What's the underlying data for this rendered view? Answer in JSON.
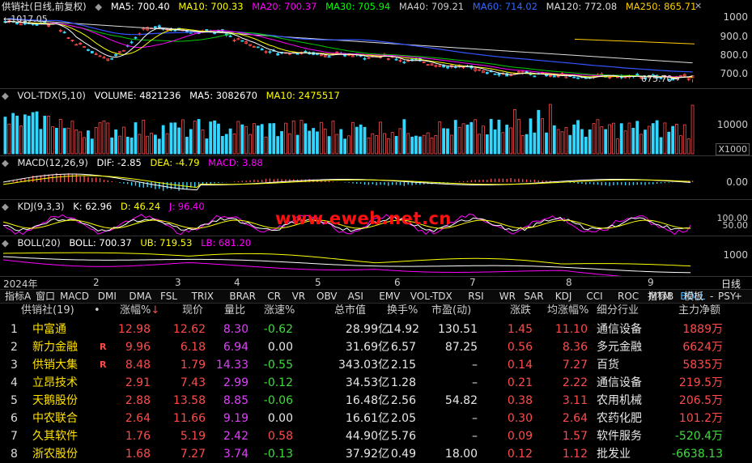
{
  "colors": {
    "up": "#ff4b4b",
    "down": "#33d6ff",
    "ma5": "#ffffff",
    "ma10": "#ffff00",
    "ma20": "#ff00ff",
    "ma30": "#00ff00",
    "ma40": "#cccccc",
    "ma60": "#3366ff",
    "ma120": "#dddddd",
    "ma250": "#ffcc00",
    "active_tab": "#49b6ff"
  },
  "price": {
    "title": "供销社(日线,前复权)",
    "ma5": "MA5: 700.40",
    "ma10": "MA10: 700.33",
    "ma20": "MA20: 700.37",
    "ma30": "MA30: 705.94",
    "ma40": "MA40: 709.21",
    "ma60": "MA60: 714.02",
    "ma120": "MA120: 772.08",
    "ma250": "MA250: 865.71",
    "high_label": "1017.05",
    "low_label": "675.70",
    "axis": [
      "1000",
      "900.0",
      "800.0",
      "700.0"
    ]
  },
  "volume": {
    "title": "VOL-TDX(5,10)",
    "volume": "VOLUME: 4821236",
    "ma5": "MA5: 3082670",
    "ma10": "MA10: 2475517",
    "axis": [
      "10000"
    ],
    "unit": "X1000"
  },
  "macd": {
    "title": "MACD(12,26,9)",
    "dif": "DIF: -2.85",
    "dea": "DEA: -4.79",
    "macd": "MACD: 3.88",
    "axis": [
      "0.00"
    ]
  },
  "kdj": {
    "title": "KDJ(9,3,3)",
    "k": "K: 62.96",
    "d": "D: 46.24",
    "j": "J: 96.40",
    "axis": [
      "100.00",
      "50.00"
    ]
  },
  "boll": {
    "title": "BOLL(20)",
    "boll": "BOLL: 700.37",
    "ub": "UB: 719.53",
    "lb": "LB: 681.20",
    "axis": [
      "1000"
    ]
  },
  "watermark": "www.eweb.net.cn",
  "timeline": {
    "year": "2024年",
    "months": [
      "2",
      "3",
      "4",
      "5",
      "6",
      "7",
      "8",
      "9"
    ],
    "period": "日线"
  },
  "tabs": [
    "指标A",
    "窗口",
    "MACD",
    "DMI",
    "DMA",
    "FSL",
    "TRIX",
    "BRAR",
    "CR",
    "VR",
    "OBV",
    "ASI",
    "EMV",
    "VOL-TDX",
    "RSI",
    "WR",
    "SAR",
    "KDJ",
    "CCI",
    "ROC",
    "MTM",
    "BOLL",
    "PSY"
  ],
  "active_tab": "BOLL",
  "tabs_right": [
    "指标B",
    "模板",
    "-",
    "+"
  ],
  "table": {
    "headers": {
      "name": "供销社(19)",
      "dot": "•",
      "chg": "涨幅%",
      "price": "现价",
      "vr": "量比",
      "speed": "涨速%",
      "mcap": "总市值",
      "turn": "换手%",
      "pe": "市盈(动)",
      "change": "涨跌",
      "avg": "均涨幅%",
      "ind": "细分行业",
      "flow": "主力净额"
    },
    "sort_arrow": "↓",
    "rows": [
      {
        "no": "1",
        "name": "中富通",
        "mark": "",
        "chg": "12.98",
        "price": "12.62",
        "vr": "8.30",
        "speed": "-0.62",
        "mcap": "28.99亿",
        "turn": "14.92",
        "pe": "130.51",
        "change": "1.45",
        "avg": "11.10",
        "ind": "通信设备",
        "flow": "1889万"
      },
      {
        "no": "2",
        "name": "新力金融",
        "mark": "R",
        "chg": "9.96",
        "price": "6.18",
        "vr": "6.94",
        "speed": "0.00",
        "mcap": "31.69亿",
        "turn": "6.57",
        "pe": "87.25",
        "change": "0.56",
        "avg": "8.36",
        "ind": "多元金融",
        "flow": "6624万"
      },
      {
        "no": "3",
        "name": "供销大集",
        "mark": "R",
        "chg": "8.48",
        "price": "1.79",
        "vr": "14.33",
        "speed": "-0.55",
        "mcap": "343.03亿",
        "turn": "2.15",
        "pe": "–",
        "change": "0.14",
        "avg": "7.27",
        "ind": "百货",
        "flow": "5835万"
      },
      {
        "no": "4",
        "name": "立昂技术",
        "mark": "",
        "chg": "2.91",
        "price": "7.43",
        "vr": "2.99",
        "speed": "-0.12",
        "mcap": "34.53亿",
        "turn": "1.28",
        "pe": "–",
        "change": "0.21",
        "avg": "2.22",
        "ind": "通信设备",
        "flow": "219.5万"
      },
      {
        "no": "5",
        "name": "天鹅股份",
        "mark": "",
        "chg": "2.88",
        "price": "13.58",
        "vr": "8.85",
        "speed": "-0.06",
        "mcap": "16.48亿",
        "turn": "2.56",
        "pe": "54.82",
        "change": "0.38",
        "avg": "3.11",
        "ind": "农用机械",
        "flow": "206.5万"
      },
      {
        "no": "6",
        "name": "中农联合",
        "mark": "",
        "chg": "2.64",
        "price": "11.66",
        "vr": "9.19",
        "speed": "0.00",
        "mcap": "16.61亿",
        "turn": "2.05",
        "pe": "–",
        "change": "0.30",
        "avg": "2.64",
        "ind": "农药化肥",
        "flow": "101.2万"
      },
      {
        "no": "7",
        "name": "久其软件",
        "mark": "",
        "chg": "1.76",
        "price": "5.19",
        "vr": "2.42",
        "speed": "0.58",
        "mcap": "44.90亿",
        "turn": "5.76",
        "pe": "–",
        "change": "0.09",
        "avg": "1.57",
        "ind": "软件服务",
        "flow": "-520.4万"
      },
      {
        "no": "8",
        "name": "浙农股份",
        "mark": "",
        "chg": "1.68",
        "price": "7.27",
        "vr": "3.74",
        "speed": "-0.13",
        "mcap": "37.92亿",
        "turn": "0.49",
        "pe": "18.00",
        "change": "0.12",
        "avg": "1.12",
        "ind": "批发业",
        "flow": "-6638.13"
      }
    ]
  }
}
